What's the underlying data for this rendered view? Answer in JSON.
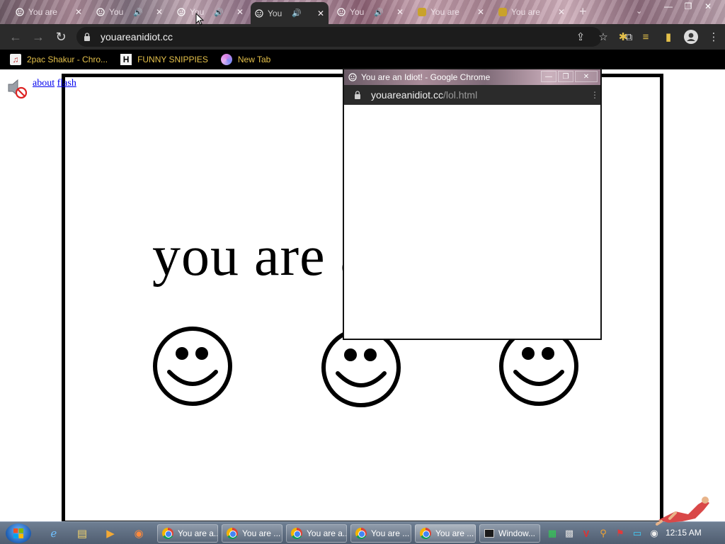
{
  "tabs": [
    {
      "label": "You are",
      "active": false,
      "audio": false
    },
    {
      "label": "You",
      "active": false,
      "audio": true
    },
    {
      "label": "You",
      "active": false,
      "audio": true
    },
    {
      "label": "You",
      "active": true,
      "audio": true
    },
    {
      "label": "You",
      "active": false,
      "audio": true
    },
    {
      "label": "You are",
      "active": false,
      "audio": false
    },
    {
      "label": "You are",
      "active": false,
      "audio": false
    }
  ],
  "window_controls": {
    "minimize": "—",
    "maximize": "❐",
    "close": "✕"
  },
  "toolbar": {
    "url": "youareanidiot.cc",
    "back": "←",
    "forward": "→",
    "reload": "↻"
  },
  "bookmarks": [
    {
      "label": "2pac Shakur - Chro...",
      "icon": "music-bookmark-icon"
    },
    {
      "label": "FUNNY SNIPPIES",
      "icon": "H"
    },
    {
      "label": "New Tab",
      "icon": "new-tab-icon"
    }
  ],
  "page": {
    "link_about": "about",
    "link_flash": "flash",
    "headline": "you are an idiot"
  },
  "popup": {
    "title": "You are an Idiot! - Google Chrome",
    "url_host": "youareanidiot.cc",
    "url_path": "/lol.html",
    "menu": "⋮"
  },
  "taskbar": {
    "tasks": [
      "You are a...",
      "You are ...",
      "You are a...",
      "You are ...",
      "You are ...",
      "Window..."
    ],
    "clock": "12:15 AM"
  },
  "colors": {
    "chrome_dark": "#2b2b2b",
    "bookmark_text": "#e4c04a",
    "link": "#0000ee"
  }
}
